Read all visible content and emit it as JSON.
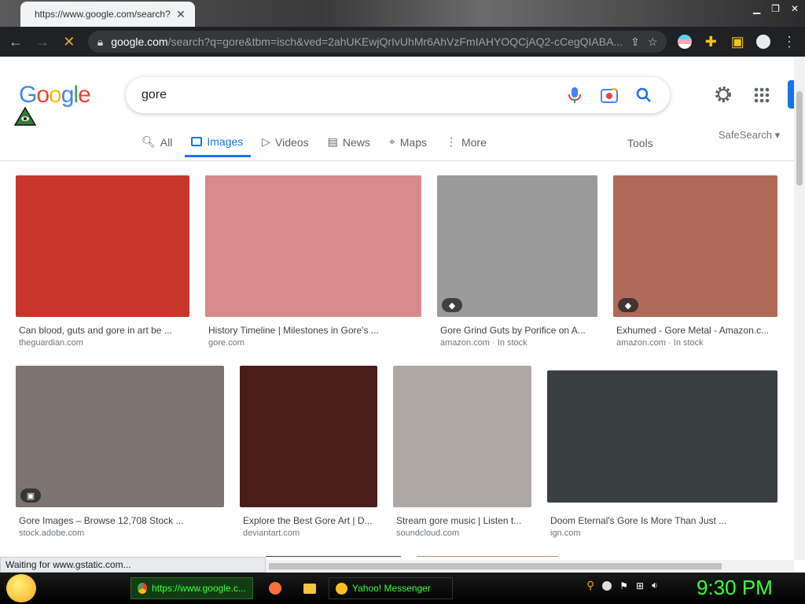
{
  "browser": {
    "tab_title": "https://www.google.com/search?",
    "url_host": "google.com",
    "url_rest": "/search?q=gore&tbm=isch&ved=2ahUKEwjQrIvUhMr6AhVzFmIAHYOQCjAQ2-cCegQIABA...",
    "status_text": "Waiting for www.gstatic.com..."
  },
  "google": {
    "logo_text": "Google",
    "query": "gore",
    "tabs": [
      {
        "label": "All"
      },
      {
        "label": "Images"
      },
      {
        "label": "Videos"
      },
      {
        "label": "News"
      },
      {
        "label": "Maps"
      },
      {
        "label": "More"
      }
    ],
    "tools_label": "Tools",
    "safesearch_label": "SafeSearch"
  },
  "results": [
    {
      "title": "Can blood, guts and gore in art be ...",
      "source": "theguardian.com",
      "extra": "",
      "color": "#c8352c"
    },
    {
      "title": "History Timeline | Milestones in Gore's ...",
      "source": "gore.com",
      "extra": "",
      "color": "#d98a8a"
    },
    {
      "title": "Gore Grind Guts by Porifice on A...",
      "source": "amazon.com",
      "extra": "In stock",
      "color": "#9a9a9a"
    },
    {
      "title": "Exhumed - Gore Metal - Amazon.c...",
      "source": "amazon.com",
      "extra": "In stock",
      "color": "#b06a5a"
    },
    {
      "title": "Gore Images – Browse 12,708 Stock ...",
      "source": "stock.adobe.com",
      "extra": "",
      "color": "#7d7470"
    },
    {
      "title": "Explore the Best Gore Art | D...",
      "source": "deviantart.com",
      "extra": "",
      "color": "#4a1c1a"
    },
    {
      "title": "Stream gore music | Listen t...",
      "source": "soundcloud.com",
      "extra": "",
      "color": "#b0a8a4"
    },
    {
      "title": "Doom Eternal's Gore Is More Than Just ...",
      "source": "ign.com",
      "extra": "",
      "color": "#3a3f42"
    }
  ],
  "taskbar": {
    "browser_task": "https://www.google.c...",
    "messenger_task": "Yahoo! Messenger",
    "clock": "9:30 PM"
  },
  "colors": {
    "accent": "#1a73e8",
    "taskbar_text": "#39ff39"
  }
}
